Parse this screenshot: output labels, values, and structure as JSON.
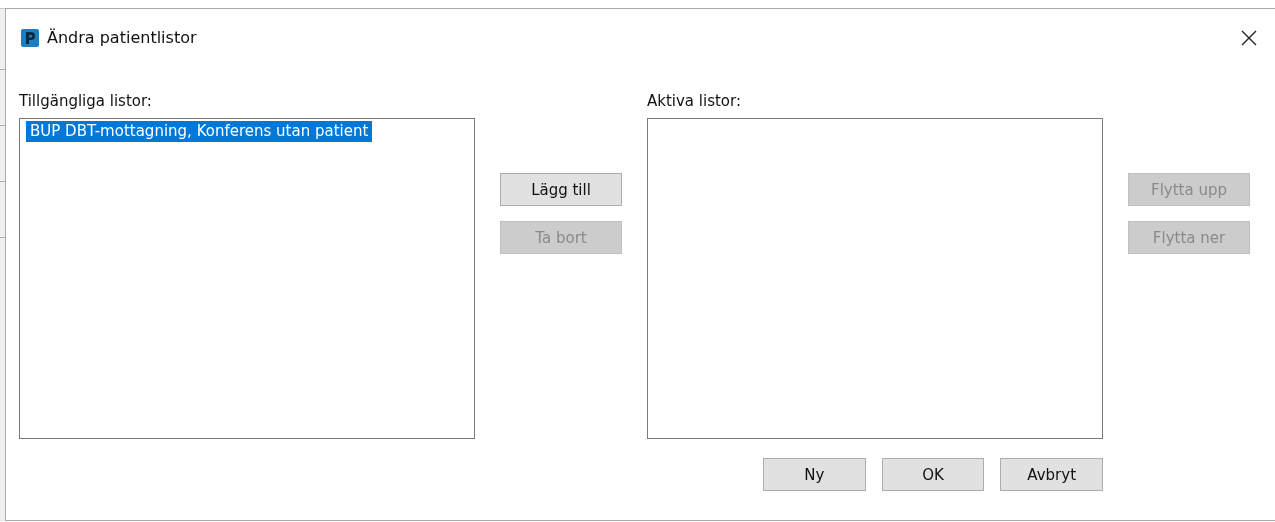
{
  "window": {
    "title": "Ändra patientlistor"
  },
  "available": {
    "label": "Tillgängliga listor:",
    "items": [
      {
        "text": "BUP DBT-mottagning, Konferens utan patient",
        "selected": true
      }
    ]
  },
  "transfer_buttons": [
    {
      "label": "Lägg till",
      "disabled": false
    },
    {
      "label": "Ta bort",
      "disabled": true
    }
  ],
  "active": {
    "label": "Aktiva listor:"
  },
  "order_buttons": [
    {
      "label": "Flytta upp",
      "disabled": true
    },
    {
      "label": "Flytta ner",
      "disabled": true
    }
  ],
  "footer_buttons": [
    {
      "label": "Ny",
      "disabled": false
    },
    {
      "label": "OK",
      "disabled": false
    },
    {
      "label": "Avbryt",
      "disabled": false
    }
  ]
}
